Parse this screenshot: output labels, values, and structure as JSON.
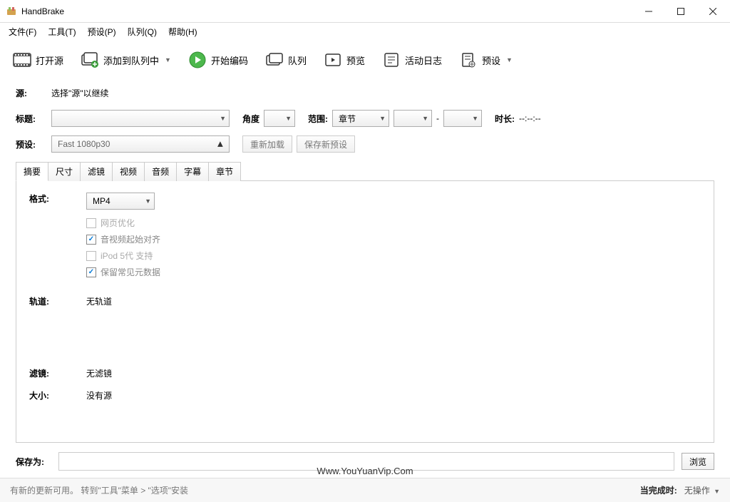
{
  "title": "HandBrake",
  "menus": {
    "file": "文件(F)",
    "tools": "工具(T)",
    "presets": "预设(P)",
    "queue": "队列(Q)",
    "help": "帮助(H)"
  },
  "toolbar": {
    "open": "打开源",
    "add_queue": "添加到队列中",
    "start": "开始编码",
    "queue": "队列",
    "preview": "预览",
    "activity": "活动日志",
    "presets": "预设"
  },
  "source": {
    "label": "源:",
    "value": "选择\"源\"以继续"
  },
  "title_row": {
    "label": "标题:",
    "angle": "角度",
    "range": "范围:",
    "range_val": "章节",
    "sep": "-",
    "duration_label": "时长:",
    "duration": "--:--:--"
  },
  "preset_row": {
    "label": "预设:",
    "value": "Fast 1080p30",
    "reload": "重新加载",
    "savenew": "保存新预设"
  },
  "tabs": [
    "摘要",
    "尺寸",
    "滤镜",
    "视频",
    "音频",
    "字幕",
    "章节"
  ],
  "summary": {
    "format_label": "格式:",
    "format_value": "MP4",
    "checks": {
      "web": "网页优化",
      "av": "音视频起始对齐",
      "ipod": "iPod 5代 支持",
      "meta": "保留常见元数据"
    },
    "tracks_label": "轨道:",
    "tracks_value": "无轨道",
    "filters_label": "滤镜:",
    "filters_value": "无滤镜",
    "size_label": "大小:",
    "size_value": "没有源"
  },
  "save": {
    "label": "保存为:",
    "browse": "浏览"
  },
  "status": {
    "update": "有新的更新可用。 转到\"工具\"菜单  >  \"选项\"安装",
    "watermark": "Www.YouYuanVip.Com",
    "done_label": "当完成时:",
    "done_action": "无操作"
  }
}
